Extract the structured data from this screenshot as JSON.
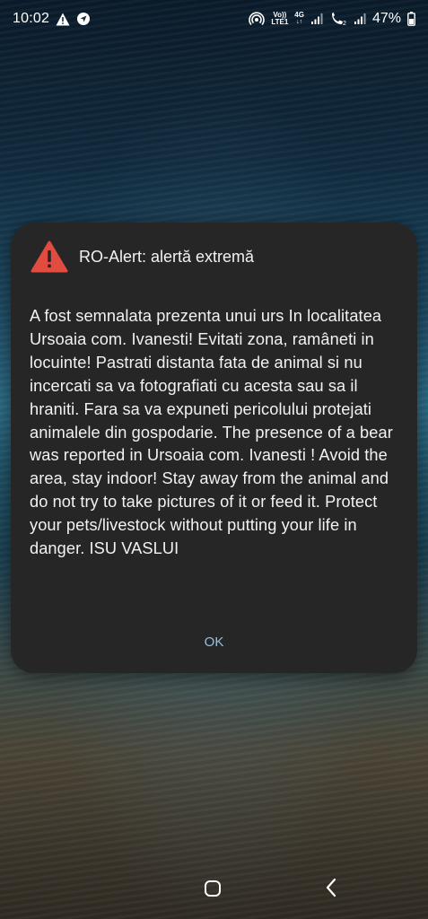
{
  "status_bar": {
    "time": "10:02",
    "volte_label": "Vo))",
    "lte1_label": "LTE1",
    "network_4g": "4G",
    "sim2_label": "2",
    "battery_percent": "47%"
  },
  "dialog": {
    "title": "RO-Alert: alertă extremă",
    "message": "A fost semnalata prezenta unui urs In localitatea Ursoaia com. Ivanesti! Evitati zona, ramâneti in locuinte! Pastrati distanta fata de animal si nu incercati sa va fotografiati cu acesta sau sa il hraniti. Fara sa va expuneti pericolului protejati animalele din gospodarie. The presence of a bear was reported in Ursoaia com. Ivanesti ! Avoid the area, stay indoor! Stay away from the animal and do not try to take pictures of it or feed it. Protect your pets/livestock without putting your life in danger. ISU VASLUI",
    "ok_label": "OK",
    "warning_color": "#e24b3f",
    "ok_color": "#8fc4e8"
  },
  "icons": {
    "status_left": [
      "warning-icon",
      "navigation-icon"
    ],
    "status_right": [
      "hotspot-icon",
      "volte-icon",
      "signal-icon",
      "call-icon",
      "signal-icon",
      "battery-icon"
    ],
    "dialog": "warning-triangle-icon",
    "nav": [
      "home-icon",
      "back-icon"
    ]
  }
}
